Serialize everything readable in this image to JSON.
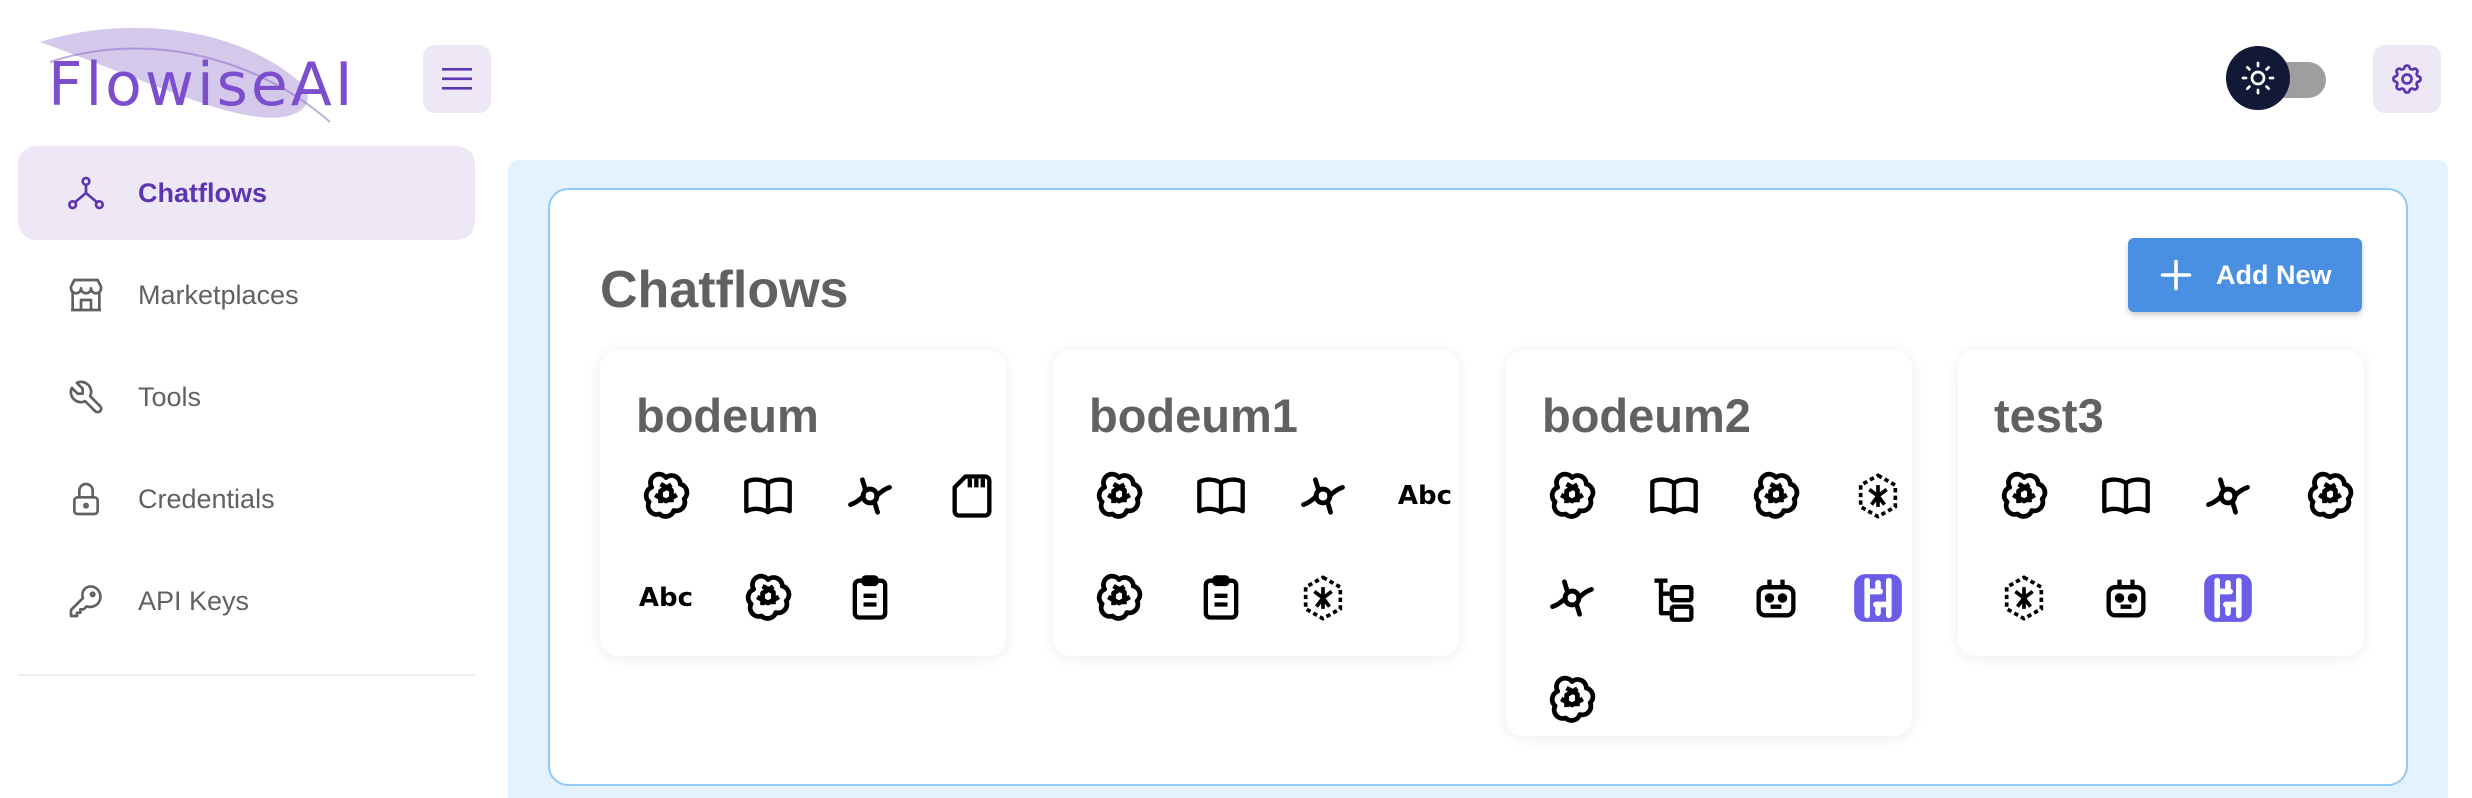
{
  "app": {
    "logo_text": "FlowiseAI"
  },
  "sidebar": {
    "items": [
      {
        "label": "Chatflows",
        "icon": "hierarchy-icon",
        "active": true
      },
      {
        "label": "Marketplaces",
        "icon": "store-icon",
        "active": false
      },
      {
        "label": "Tools",
        "icon": "wrench-icon",
        "active": false
      },
      {
        "label": "Credentials",
        "icon": "lock-icon",
        "active": false
      },
      {
        "label": "API Keys",
        "icon": "key-icon",
        "active": false
      }
    ]
  },
  "header": {
    "theme": "light",
    "theme_toggle_icon": "sun-icon",
    "settings_icon": "gear-icon",
    "menu_icon": "hamburger-icon"
  },
  "main": {
    "title": "Chatflows",
    "add_button_label": "Add New",
    "cards": [
      {
        "name": "bodeum",
        "icons": [
          "openai-icon",
          "book-icon",
          "vector-icon",
          "file-icon",
          "text-splitter-icon",
          "openai-icon",
          "clipboard-icon"
        ]
      },
      {
        "name": "bodeum1",
        "icons": [
          "openai-icon",
          "book-icon",
          "vector-icon",
          "text-splitter-icon",
          "openai-icon",
          "clipboard-icon",
          "chain-icon"
        ]
      },
      {
        "name": "bodeum2",
        "icons": [
          "openai-icon",
          "book-icon",
          "openai-icon",
          "chain-icon",
          "vector-icon",
          "tree-icon",
          "robot-icon",
          "flow-icon",
          "openai-icon"
        ]
      },
      {
        "name": "test3",
        "icons": [
          "openai-icon",
          "book-icon",
          "vector-icon",
          "openai-icon",
          "chain-icon",
          "robot-icon",
          "flow-icon"
        ]
      }
    ],
    "text_splitter_label": "Abc"
  },
  "colors": {
    "accent": "#5e35b1",
    "primary_button": "#4a90e2",
    "main_bg": "#e3f2fd",
    "nav_active_bg": "#ede7f6"
  }
}
